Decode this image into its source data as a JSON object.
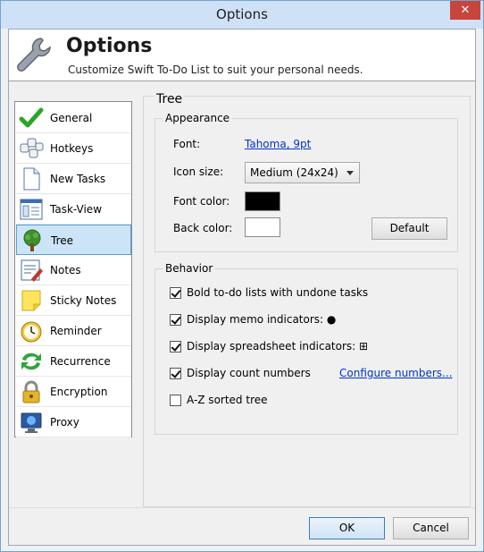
{
  "window": {
    "title": "Options",
    "close_glyph": "✕"
  },
  "header": {
    "title": "Options",
    "subtitle": "Customize Swift To-Do List to suit your personal needs.",
    "icon": "wrench-icon"
  },
  "nav": {
    "selected": "Tree",
    "items": [
      {
        "label": "General",
        "icon": "checkmark-icon"
      },
      {
        "label": "Hotkeys",
        "icon": "keyboard-icon"
      },
      {
        "label": "New Tasks",
        "icon": "new-document-icon"
      },
      {
        "label": "Task-View",
        "icon": "task-view-icon"
      },
      {
        "label": "Tree",
        "icon": "tree-icon"
      },
      {
        "label": "Notes",
        "icon": "notes-icon"
      },
      {
        "label": "Sticky Notes",
        "icon": "sticky-note-icon"
      },
      {
        "label": "Reminder",
        "icon": "alarm-clock-icon"
      },
      {
        "label": "Recurrence",
        "icon": "recurrence-arrows-icon"
      },
      {
        "label": "Encryption",
        "icon": "padlock-icon"
      },
      {
        "label": "Proxy",
        "icon": "monitor-globe-icon"
      }
    ]
  },
  "panel": {
    "title": "Tree",
    "appearance": {
      "title": "Appearance",
      "font_label": "Font:",
      "font_value": "Tahoma, 9pt",
      "icon_size_label": "Icon size:",
      "icon_size_value": "Medium (24x24)",
      "font_color_label": "Font color:",
      "font_color": "#000000",
      "back_color_label": "Back color:",
      "back_color": "#ffffff",
      "default_button": "Default"
    },
    "behavior": {
      "title": "Behavior",
      "options": [
        {
          "label": "Bold to-do lists with undone tasks",
          "checked": true
        },
        {
          "label": "Display memo indicators: ●",
          "checked": true
        },
        {
          "label": "Display spreadsheet indicators: ⊞",
          "checked": true
        },
        {
          "label": "Display count numbers",
          "checked": true
        },
        {
          "label": "A-Z sorted tree",
          "checked": false
        }
      ],
      "configure_link": "Configure numbers..."
    }
  },
  "footer": {
    "ok": "OK",
    "cancel": "Cancel"
  },
  "colors": {
    "selection": "#cce4f7",
    "selection_border": "#5a9ed6",
    "link": "#0033cc",
    "titlebar": "#cfe1f6",
    "close": "#c7453b"
  }
}
